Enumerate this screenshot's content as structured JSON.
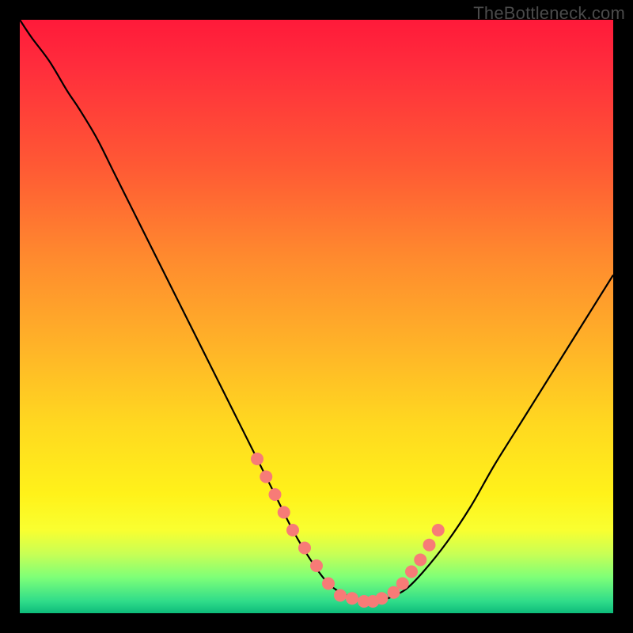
{
  "watermark": "TheBottleneck.com",
  "colors": {
    "background": "#000000",
    "curve": "#000000",
    "marker": "#f77b77"
  },
  "chart_data": {
    "type": "line",
    "title": "",
    "xlabel": "",
    "ylabel": "",
    "xlim": [
      0,
      100
    ],
    "ylim": [
      0,
      100
    ],
    "x": [
      0,
      2,
      5,
      8,
      10,
      13,
      16,
      20,
      24,
      28,
      32,
      36,
      40,
      43,
      46,
      49,
      52,
      55,
      58,
      60,
      62,
      65,
      68,
      72,
      76,
      80,
      85,
      90,
      95,
      100
    ],
    "y": [
      100,
      97,
      93,
      88,
      85,
      80,
      74,
      66,
      58,
      50,
      42,
      34,
      26,
      20,
      14,
      9,
      5,
      3,
      2,
      2,
      2.5,
      4,
      7,
      12,
      18,
      25,
      33,
      41,
      49,
      57
    ],
    "markers": {
      "x": [
        40,
        41.5,
        43,
        44.5,
        46,
        48,
        50,
        52,
        54,
        56,
        58,
        59.5,
        61,
        63,
        64.5,
        66,
        67.5,
        69,
        70.5
      ],
      "y": [
        26,
        23,
        20,
        17,
        14,
        11,
        8,
        5,
        3,
        2.5,
        2,
        2,
        2.5,
        3.5,
        5,
        7,
        9,
        11.5,
        14
      ]
    }
  }
}
